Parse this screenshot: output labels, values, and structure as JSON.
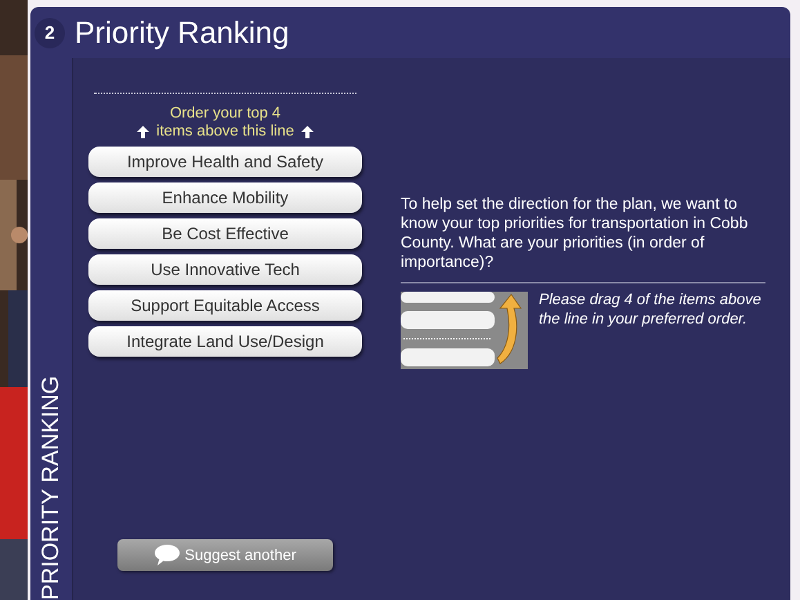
{
  "step": "2",
  "title": "Priority Ranking",
  "side_tab": "PRIORITY RANKING",
  "instruction": {
    "line_1": "Order your top 4",
    "line_2": "items above this line"
  },
  "items": [
    {
      "label": "Improve Health and Safety"
    },
    {
      "label": "Enhance Mobility"
    },
    {
      "label": "Be Cost Effective"
    },
    {
      "label": "Use Innovative Tech"
    },
    {
      "label": "Support Equitable Access"
    },
    {
      "label": "Integrate Land Use/Design"
    }
  ],
  "description": "To help set the direction for the plan, we want to know your top priorities for transportation in Cobb County. What are your priorities (in order of importance)?",
  "hint": "Please drag 4 of the items above the line in your preferred order.",
  "suggest_button": "Suggest another"
}
